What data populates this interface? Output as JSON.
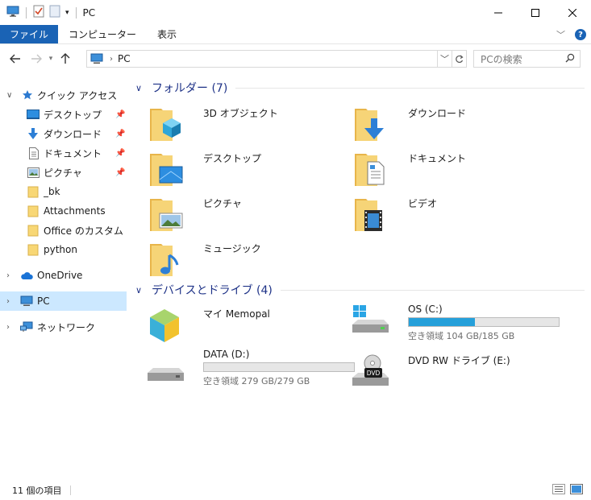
{
  "window": {
    "title": "PC"
  },
  "ribbon": {
    "tabs": [
      "ファイル",
      "コンピューター",
      "表示"
    ]
  },
  "address": {
    "crumb": "PC"
  },
  "search": {
    "placeholder": "PCの検索"
  },
  "sidebar": {
    "quick_access": "クイック アクセス",
    "items": [
      {
        "label": "デスクトップ",
        "pinned": true,
        "icon": "desktop-icon"
      },
      {
        "label": "ダウンロード",
        "pinned": true,
        "icon": "download-icon"
      },
      {
        "label": "ドキュメント",
        "pinned": true,
        "icon": "document-icon"
      },
      {
        "label": "ピクチャ",
        "pinned": true,
        "icon": "picture-icon"
      },
      {
        "label": "_bk",
        "pinned": false,
        "icon": "folder-icon"
      },
      {
        "label": "Attachments",
        "pinned": false,
        "icon": "folder-icon"
      },
      {
        "label": "Office のカスタム テンプレート",
        "pinned": false,
        "icon": "folder-icon"
      },
      {
        "label": "python",
        "pinned": false,
        "icon": "folder-icon"
      }
    ],
    "onedrive": "OneDrive",
    "pc": "PC",
    "network": "ネットワーク"
  },
  "folders": {
    "header": "フォルダー (7)",
    "items": [
      {
        "label": "3D オブジェクト",
        "icon": "3d-objects-icon"
      },
      {
        "label": "ダウンロード",
        "icon": "downloads-folder-icon"
      },
      {
        "label": "デスクトップ",
        "icon": "desktop-folder-icon"
      },
      {
        "label": "ドキュメント",
        "icon": "documents-folder-icon"
      },
      {
        "label": "ピクチャ",
        "icon": "pictures-folder-icon"
      },
      {
        "label": "ビデオ",
        "icon": "videos-folder-icon"
      },
      {
        "label": "ミュージック",
        "icon": "music-folder-icon"
      }
    ]
  },
  "devices": {
    "header": "デバイスとドライブ (4)",
    "items": [
      {
        "label": "マイ Memopal",
        "icon": "memopal-icon"
      },
      {
        "label": "OS (C:)",
        "free": "空き領域 104 GB/185 GB",
        "used_fraction": 0.44,
        "icon": "windows-drive-icon"
      },
      {
        "label": "DATA (D:)",
        "free": "空き領域 279 GB/279 GB",
        "used_fraction": 0.0,
        "icon": "hard-drive-icon"
      },
      {
        "label": "DVD RW ドライブ (E:)",
        "icon": "dvd-drive-icon"
      }
    ]
  },
  "status": {
    "count": "11 個の項目"
  },
  "colors": {
    "accent": "#1a63b5",
    "selected": "#cce8ff",
    "drive_fill": "#26a0da",
    "group_header": "#1e3287"
  }
}
